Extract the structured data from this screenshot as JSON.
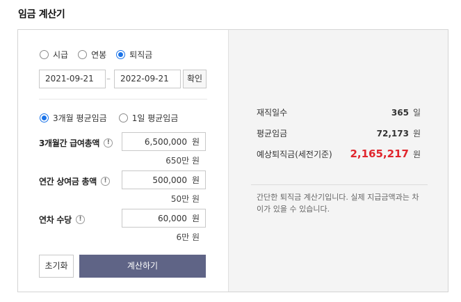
{
  "title": "임금 계산기",
  "pay_type": {
    "options": [
      {
        "label": "시급",
        "checked": false
      },
      {
        "label": "연봉",
        "checked": false
      },
      {
        "label": "퇴직금",
        "checked": true
      }
    ]
  },
  "period": {
    "start": "2021-09-21",
    "end": "2022-09-21",
    "confirm_label": "확인"
  },
  "wage_basis": {
    "options": [
      {
        "label": "3개월 평균임금",
        "checked": true
      },
      {
        "label": "1일 평균임금",
        "checked": false
      }
    ]
  },
  "fields": [
    {
      "label": "3개월간 급여총액",
      "value": "6,500,000",
      "unit": "원",
      "sub": "650만 원"
    },
    {
      "label": "연간 상여금 총액",
      "value": "500,000",
      "unit": "원",
      "sub": "50만 원"
    },
    {
      "label": "연차 수당",
      "value": "60,000",
      "unit": "원",
      "sub": "6만 원"
    }
  ],
  "info_glyph": "!",
  "buttons": {
    "reset": "초기화",
    "calculate": "계산하기"
  },
  "results": [
    {
      "label": "재직일수",
      "value": "365",
      "unit": "일"
    },
    {
      "label": "평균임금",
      "value": "72,173",
      "unit": "원"
    },
    {
      "label": "예상퇴직금(세전기준)",
      "value": "2,165,217",
      "unit": "원"
    }
  ],
  "note": "간단한 퇴직금 계산기입니다. 실제 지급금액과는 차이가 있을 수 있습니다.",
  "colors": {
    "accent": "#1a73e8",
    "calc_button": "#5f6486",
    "highlight": "#e0262d",
    "result_bg": "#f4f4f4"
  }
}
